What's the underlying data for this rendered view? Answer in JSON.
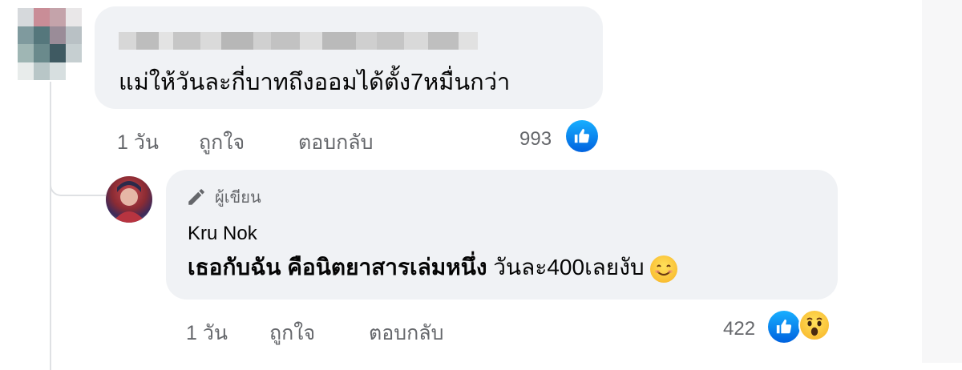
{
  "comment1": {
    "text": "แม่ให้วันละกี่บาทถึงออมได้ตั้ง7หมื่นกว่า",
    "time": "1 วัน",
    "like_label": "ถูกใจ",
    "reply_label": "ตอบกลับ",
    "reaction_count": "993"
  },
  "comment2": {
    "badge": "ผู้เขียน",
    "author": "Kru Nok",
    "text_bold": "เธอกับฉัน คือนิตยาสารเล่มหนึ่ง",
    "text_plain": "วันละ400เลยงับ",
    "time": "1 วัน",
    "like_label": "ถูกใจ",
    "reply_label": "ตอบกลับ",
    "reaction_count": "422"
  },
  "icons": {
    "like": "thumbs-up-icon",
    "wow": "wow-reaction-icon",
    "pencil": "pencil-icon",
    "smile": "smiling-face-emoji"
  },
  "colors": {
    "bubble": "#f0f2f5",
    "secondary_text": "#65676b",
    "like_blue": "#0866ff"
  }
}
